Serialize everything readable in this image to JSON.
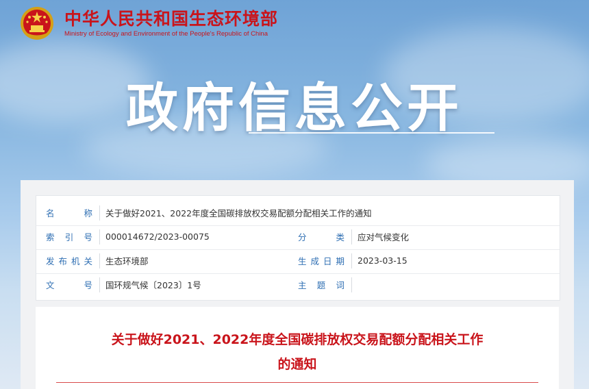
{
  "site": {
    "name_cn": "中华人民共和国生态环境部",
    "name_en": "Ministry of Ecology and Environment of the People's Republic of China"
  },
  "hero": {
    "title": "政府信息公开"
  },
  "meta": {
    "name_label": "名　　称",
    "name_value": "关于做好2021、2022年度全国碳排放权交易配额分配相关工作的通知",
    "index_label": "索 引 号",
    "index_value": "000014672/2023-00075",
    "category_label": "分　　类",
    "category_value": "应对气候变化",
    "publisher_label": "发布机关",
    "publisher_value": "生态环境部",
    "date_label": "生成日期",
    "date_value": "2023-03-15",
    "doc_no_label": "文　　号",
    "doc_no_value": "国环规气候〔2023〕1号",
    "topic_label": "主 题 词",
    "topic_value": ""
  },
  "document": {
    "title_line1": "关于做好2021、2022年度全国碳排放权交易配额分配相关工作",
    "title_line2": "的通知"
  },
  "colors": {
    "brand_red": "#c9141b",
    "label_blue": "#2f6fb3"
  }
}
